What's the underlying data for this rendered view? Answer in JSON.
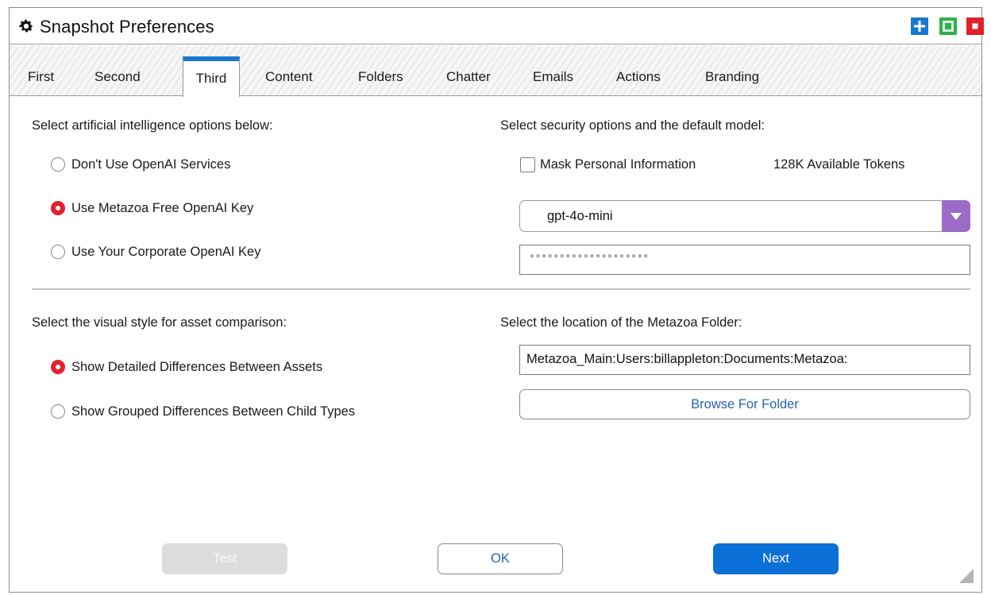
{
  "window": {
    "title": "Snapshot Preferences",
    "icon": "gear-icon",
    "controls": [
      "plus-icon",
      "maximize-icon",
      "close-icon"
    ],
    "colors": {
      "plus": "#1b78d0",
      "maximize": "#2db24a",
      "close": "#e0202a"
    }
  },
  "tabs": [
    {
      "label": "First"
    },
    {
      "label": "Second"
    },
    {
      "label": "Third",
      "active": true
    },
    {
      "label": "Content"
    },
    {
      "label": "Folders"
    },
    {
      "label": "Chatter"
    },
    {
      "label": "Emails"
    },
    {
      "label": "Actions"
    },
    {
      "label": "Branding"
    }
  ],
  "ai": {
    "heading": "Select artificial intelligence options below:",
    "options": [
      {
        "label": "Don't Use OpenAI Services",
        "selected": false
      },
      {
        "label": "Use Metazoa Free OpenAI Key",
        "selected": true
      },
      {
        "label": "Use Your Corporate OpenAI Key",
        "selected": false
      }
    ]
  },
  "security": {
    "heading": "Select security options and the default model:",
    "mask_label": "Mask Personal Information",
    "mask_checked": false,
    "tokens": "128K Available Tokens",
    "model": "gpt-4o-mini",
    "key_placeholder": "●●●●●●●●●●●●●●●●●●●●"
  },
  "visual": {
    "heading": "Select the visual style for asset comparison:",
    "options": [
      {
        "label": "Show Detailed Differences Between Assets",
        "selected": true
      },
      {
        "label": "Show Grouped Differences Between Child Types",
        "selected": false
      }
    ]
  },
  "folder": {
    "heading": "Select the location of the Metazoa Folder:",
    "path": "Metazoa_Main:Users:billappleton:Documents:Metazoa:",
    "browse_label": "Browse For Folder"
  },
  "footer": {
    "test_label": "Test",
    "ok_label": "OK",
    "next_label": "Next"
  },
  "colors": {
    "accent": "#1b78d0",
    "radio_selected": "#e3202e",
    "dropdown_arrow": "#9b6bc6",
    "primary_button": "#0a6fd6"
  }
}
